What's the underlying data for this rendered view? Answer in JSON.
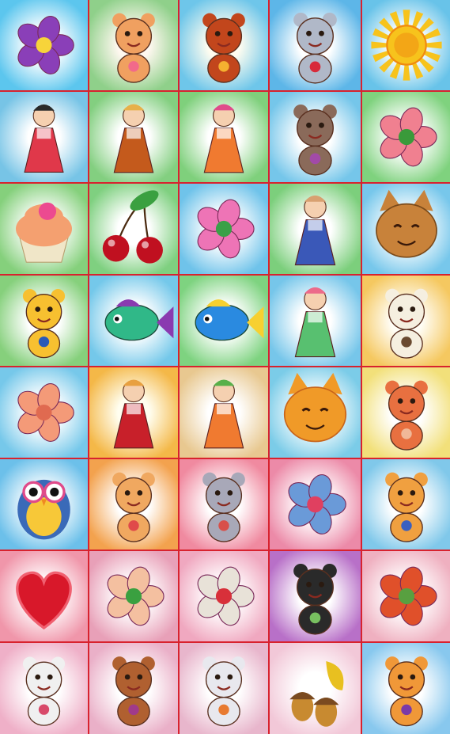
{
  "sheet": {
    "grid_line_color": "#d8222e",
    "columns": 5,
    "rows": 8
  },
  "tiles": [
    {
      "icon": "pansy-flowers-icon",
      "glow": "#ffffff",
      "bg": "#5cc6ee",
      "main": "#8a3fb8",
      "accent": "#f7d43a"
    },
    {
      "icon": "kitten-with-heart-icon",
      "glow": "#fff8f0",
      "bg": "#8fd08a",
      "main": "#f0a060",
      "accent": "#f26a8a"
    },
    {
      "icon": "squirrel-icon",
      "glow": "#fffdf0",
      "bg": "#6ec6ea",
      "main": "#c2461c",
      "accent": "#f5b030"
    },
    {
      "icon": "bunny-in-frame-icon",
      "glow": "#ffffff",
      "bg": "#5db6e8",
      "main": "#b0b8c8",
      "accent": "#d82a3a"
    },
    {
      "icon": "sun-icon",
      "glow": "#ffffff",
      "bg": "#68c3e9",
      "main": "#f7c31c",
      "accent": "#f08a10"
    },
    {
      "icon": "girl-in-folk-dress-icon",
      "glow": "#ffffff",
      "bg": "#77c4e6",
      "main": "#e0384a",
      "accent": "#2a2a2a"
    },
    {
      "icon": "gnome-with-lute-icon",
      "glow": "#ffffff",
      "bg": "#83cf80",
      "main": "#c45a1c",
      "accent": "#e7b04a"
    },
    {
      "icon": "fairy-with-heart-icon",
      "glow": "#ffffff",
      "bg": "#7fd07c",
      "main": "#f07a30",
      "accent": "#e04a8a"
    },
    {
      "icon": "mouse-with-bow-icon",
      "glow": "#ffffff",
      "bg": "#75c6ea",
      "main": "#8a6a5a",
      "accent": "#a24aa8"
    },
    {
      "icon": "rose-icon",
      "glow": "#ffffff",
      "bg": "#7fd27e",
      "main": "#f08090",
      "accent": "#3a9a3a"
    },
    {
      "icon": "cupcake-icon",
      "glow": "#ffffff",
      "bg": "#85d07c",
      "main": "#f4a070",
      "accent": "#ec4a90"
    },
    {
      "icon": "cherries-icon",
      "glow": "#ffffff",
      "bg": "#7fd080",
      "main": "#c01020",
      "accent": "#3aa040"
    },
    {
      "icon": "pink-flower-icon",
      "glow": "#ffffff",
      "bg": "#6fc3ea",
      "main": "#ee74b6",
      "accent": "#3aa048"
    },
    {
      "icon": "girl-in-blue-dress-icon",
      "glow": "#ffffff",
      "bg": "#7ccf7c",
      "main": "#3a58b8",
      "accent": "#d8a070"
    },
    {
      "icon": "cat-face-icon",
      "glow": "#ffffff",
      "bg": "#77c7eb",
      "main": "#c8823a",
      "accent": "#7a4a1a"
    },
    {
      "icon": "hedgehog-icon",
      "glow": "#ffffff",
      "bg": "#86d07c",
      "main": "#f7c030",
      "accent": "#2a5ab8"
    },
    {
      "icon": "green-fish-icon",
      "glow": "#ffffff",
      "bg": "#74c8ea",
      "main": "#30b888",
      "accent": "#8a3ab0"
    },
    {
      "icon": "blue-fish-icon",
      "glow": "#ffffff",
      "bg": "#7ed380",
      "main": "#2a8ae0",
      "accent": "#f7d030"
    },
    {
      "icon": "green-fairy-icon",
      "glow": "#ffffff",
      "bg": "#76c6ea",
      "main": "#58c070",
      "accent": "#ec6a8a"
    },
    {
      "icon": "panda-with-heart-icon",
      "glow": "#fffdf5",
      "bg": "#f5c860",
      "main": "#f5efe0",
      "accent": "#6a4a30"
    },
    {
      "icon": "peach-rose-icon",
      "glow": "#ffffff",
      "bg": "#76c8ea",
      "main": "#f49a78",
      "accent": "#e06a50"
    },
    {
      "icon": "girl-in-red-sarafan-icon",
      "glow": "#fffef0",
      "bg": "#f4b848",
      "main": "#c8202a",
      "accent": "#e8a040"
    },
    {
      "icon": "flower-fairy-icon",
      "glow": "#ffffff",
      "bg": "#e8c890",
      "main": "#f07a30",
      "accent": "#58b04a"
    },
    {
      "icon": "smiling-cat-face-icon",
      "glow": "#ffffff",
      "bg": "#7bcce8",
      "main": "#f09a28",
      "accent": "#c8641a"
    },
    {
      "icon": "bear-cub-icon",
      "glow": "#ffffff",
      "bg": "#f2e07a",
      "main": "#e87040",
      "accent": "#f0b898"
    },
    {
      "icon": "owl-icon",
      "glow": "#ffffff",
      "bg": "#6cc0ea",
      "main": "#f7c838",
      "accent": "#3a6ab8"
    },
    {
      "icon": "dog-puppy-icon",
      "glow": "#ffffff",
      "bg": "#f3a24e",
      "main": "#f0a860",
      "accent": "#e04a4a"
    },
    {
      "icon": "gray-bunny-icon",
      "glow": "#ffffff",
      "bg": "#f08aa0",
      "main": "#a8a8b8",
      "accent": "#d8504a"
    },
    {
      "icon": "kitten-in-flowers-icon",
      "glow": "#ffffff",
      "bg": "#ec8aa8",
      "main": "#6a9ad8",
      "accent": "#e04060"
    },
    {
      "icon": "duckling-in-cap-icon",
      "glow": "#ffffff",
      "bg": "#80c8ea",
      "main": "#f0a040",
      "accent": "#3a60c0"
    },
    {
      "icon": "heart-icon",
      "glow": "#ffffff",
      "bg": "#f096aa",
      "main": "#d8182a",
      "accent": "#f06070"
    },
    {
      "icon": "peony-flowers-icon",
      "glow": "#ffffff",
      "bg": "#e8a0b8",
      "main": "#f4c0a0",
      "accent": "#3aa040"
    },
    {
      "icon": "bunny-with-roses-icon",
      "glow": "#ffffff",
      "bg": "#f0a8c0",
      "main": "#e8e2d8",
      "accent": "#d8303a"
    },
    {
      "icon": "panda-in-dress-icon",
      "glow": "#ffffff",
      "bg": "#b870c8",
      "main": "#2a2a2a",
      "accent": "#78c060"
    },
    {
      "icon": "red-flower-icon",
      "glow": "#ffffff",
      "bg": "#efb0c0",
      "main": "#e0502a",
      "accent": "#58a040"
    },
    {
      "icon": "cat-in-basket-icon",
      "glow": "#ffffff",
      "bg": "#efb0c8",
      "main": "#f0f0f0",
      "accent": "#d84a6a"
    },
    {
      "icon": "monkey-icon",
      "glow": "#ffffff",
      "bg": "#eab0c8",
      "main": "#b06030",
      "accent": "#a03a8a"
    },
    {
      "icon": "goose-icon",
      "glow": "#ffffff",
      "bg": "#e8b6cc",
      "main": "#e8e8ee",
      "accent": "#e87a30"
    },
    {
      "icon": "acorns-and-leaf-icon",
      "glow": "#ffffff",
      "bg": "#f2c8d8",
      "main": "#c88a30",
      "accent": "#e8c020"
    },
    {
      "icon": "tiger-cub-icon",
      "glow": "#ffffff",
      "bg": "#88c8ee",
      "main": "#f09838",
      "accent": "#7a3aa8"
    }
  ]
}
